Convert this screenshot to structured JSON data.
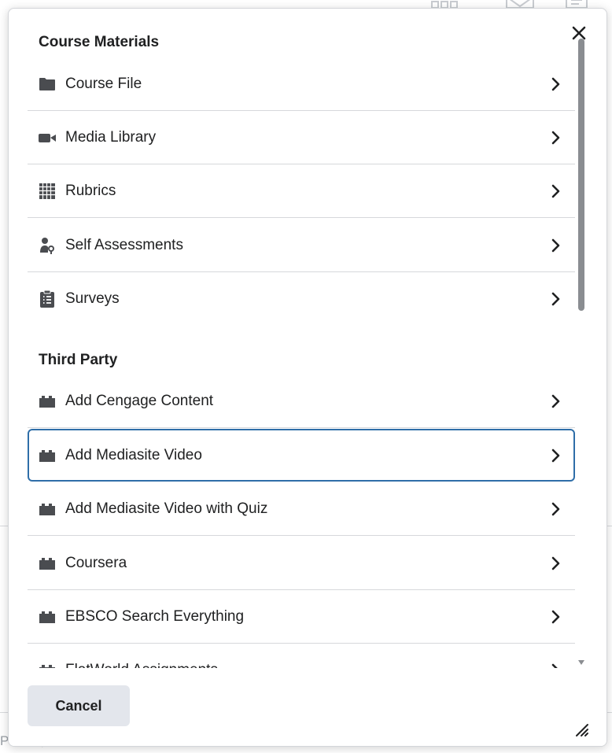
{
  "dialog": {
    "close_label": "Close",
    "sections": [
      {
        "title": "Course Materials",
        "items": [
          {
            "label": "Course File",
            "icon": "folder-icon"
          },
          {
            "label": "Media Library",
            "icon": "video-camera-icon"
          },
          {
            "label": "Rubrics",
            "icon": "grid-icon"
          },
          {
            "label": "Self Assessments",
            "icon": "person-key-icon"
          },
          {
            "label": "Surveys",
            "icon": "clipboard-list-icon"
          }
        ]
      },
      {
        "title": "Third Party",
        "items": [
          {
            "label": "Add Cengage Content",
            "icon": "plugin-icon"
          },
          {
            "label": "Add Mediasite Video",
            "icon": "plugin-icon",
            "selected": true
          },
          {
            "label": "Add Mediasite Video with Quiz",
            "icon": "plugin-icon"
          },
          {
            "label": "Coursera",
            "icon": "plugin-icon"
          },
          {
            "label": "EBSCO Search Everything",
            "icon": "plugin-icon"
          },
          {
            "label": "FlatWorld Assignments",
            "icon": "plugin-icon"
          }
        ]
      }
    ],
    "footer": {
      "cancel_label": "Cancel"
    }
  },
  "background": {
    "footer_hint": "P Files, click the SCORM icon"
  },
  "colors": {
    "selected_border": "#2f6ea8",
    "cancel_bg": "#e3e6ec",
    "text": "#202122",
    "divider": "#d6d8db"
  }
}
